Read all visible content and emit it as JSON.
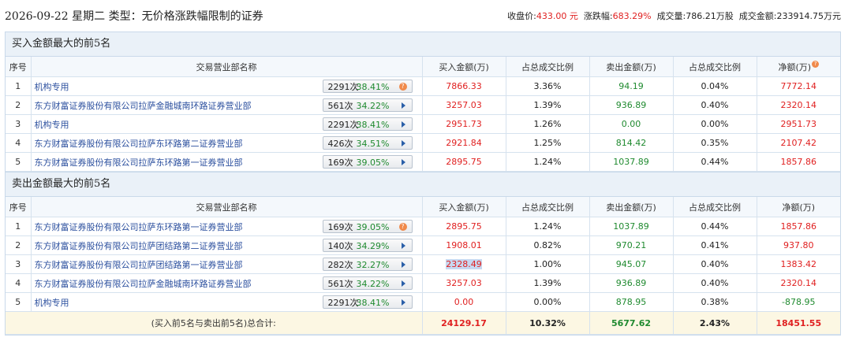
{
  "header": {
    "title": "2026-09-22 星期二 类型：无价格涨跌幅限制的证券",
    "close_label": "收盘价:",
    "close_value": "433.00 元",
    "change_label": "涨跌幅:",
    "change_value": "683.29%",
    "volume_label": "成交量:",
    "volume_value": "786.21万股",
    "turnover_label": "成交金额:",
    "turnover_value": "233914.75万元"
  },
  "columns": {
    "index": "序号",
    "dept": "交易营业部名称",
    "buy": "买入金额(万)",
    "buy_ratio": "占总成交比例",
    "sell": "卖出金额(万)",
    "sell_ratio": "占总成交比例",
    "net": "净额(万)"
  },
  "buy_section": {
    "title": "买入金额最大的前5名",
    "rows": [
      {
        "idx": "1",
        "name": "机构专用",
        "count": "2291次",
        "pct": "38.41%",
        "buy": "7866.33",
        "buy_ratio": "3.36%",
        "sell": "94.19",
        "sell_ratio": "0.04%",
        "net": "7772.14"
      },
      {
        "idx": "2",
        "name": "东方财富证券股份有限公司拉萨金融城南环路证券营业部",
        "count": "561次",
        "pct": "34.22%",
        "buy": "3257.03",
        "buy_ratio": "1.39%",
        "sell": "936.89",
        "sell_ratio": "0.40%",
        "net": "2320.14"
      },
      {
        "idx": "3",
        "name": "机构专用",
        "count": "2291次",
        "pct": "38.41%",
        "buy": "2951.73",
        "buy_ratio": "1.26%",
        "sell": "0.00",
        "sell_ratio": "0.00%",
        "net": "2951.73"
      },
      {
        "idx": "4",
        "name": "东方财富证券股份有限公司拉萨东环路第二证券营业部",
        "count": "426次",
        "pct": "34.51%",
        "buy": "2921.84",
        "buy_ratio": "1.25%",
        "sell": "814.42",
        "sell_ratio": "0.35%",
        "net": "2107.42"
      },
      {
        "idx": "5",
        "name": "东方财富证券股份有限公司拉萨东环路第一证券营业部",
        "count": "169次",
        "pct": "39.05%",
        "buy": "2895.75",
        "buy_ratio": "1.24%",
        "sell": "1037.89",
        "sell_ratio": "0.44%",
        "net": "1857.86"
      }
    ]
  },
  "sell_section": {
    "title": "卖出金额最大的前5名",
    "rows": [
      {
        "idx": "1",
        "name": "东方财富证券股份有限公司拉萨东环路第一证券营业部",
        "count": "169次",
        "pct": "39.05%",
        "buy": "2895.75",
        "buy_ratio": "1.24%",
        "sell": "1037.89",
        "sell_ratio": "0.44%",
        "net": "1857.86"
      },
      {
        "idx": "2",
        "name": "东方财富证券股份有限公司拉萨团结路第二证券营业部",
        "count": "140次",
        "pct": "34.29%",
        "buy": "1908.01",
        "buy_ratio": "0.82%",
        "sell": "970.21",
        "sell_ratio": "0.41%",
        "net": "937.80"
      },
      {
        "idx": "3",
        "name": "东方财富证券股份有限公司拉萨团结路第一证券营业部",
        "count": "282次",
        "pct": "32.27%",
        "buy": "2328.49",
        "buy_ratio": "1.00%",
        "sell": "945.07",
        "sell_ratio": "0.40%",
        "net": "1383.42"
      },
      {
        "idx": "4",
        "name": "东方财富证券股份有限公司拉萨金融城南环路证券营业部",
        "count": "561次",
        "pct": "34.22%",
        "buy": "3257.03",
        "buy_ratio": "1.39%",
        "sell": "936.89",
        "sell_ratio": "0.40%",
        "net": "2320.14"
      },
      {
        "idx": "5",
        "name": "机构专用",
        "count": "2291次",
        "pct": "38.41%",
        "buy": "0.00",
        "buy_ratio": "0.00%",
        "sell": "878.95",
        "sell_ratio": "0.38%",
        "net": "-878.95"
      }
    ]
  },
  "total": {
    "label": "(买入前5名与卖出前5名)总合计:",
    "buy": "24129.17",
    "buy_ratio": "10.32%",
    "sell": "5677.62",
    "sell_ratio": "2.43%",
    "net": "18451.55"
  },
  "colors": {
    "up": "#e02020",
    "down": "#1f8a2f",
    "link": "#2b4f9e"
  }
}
